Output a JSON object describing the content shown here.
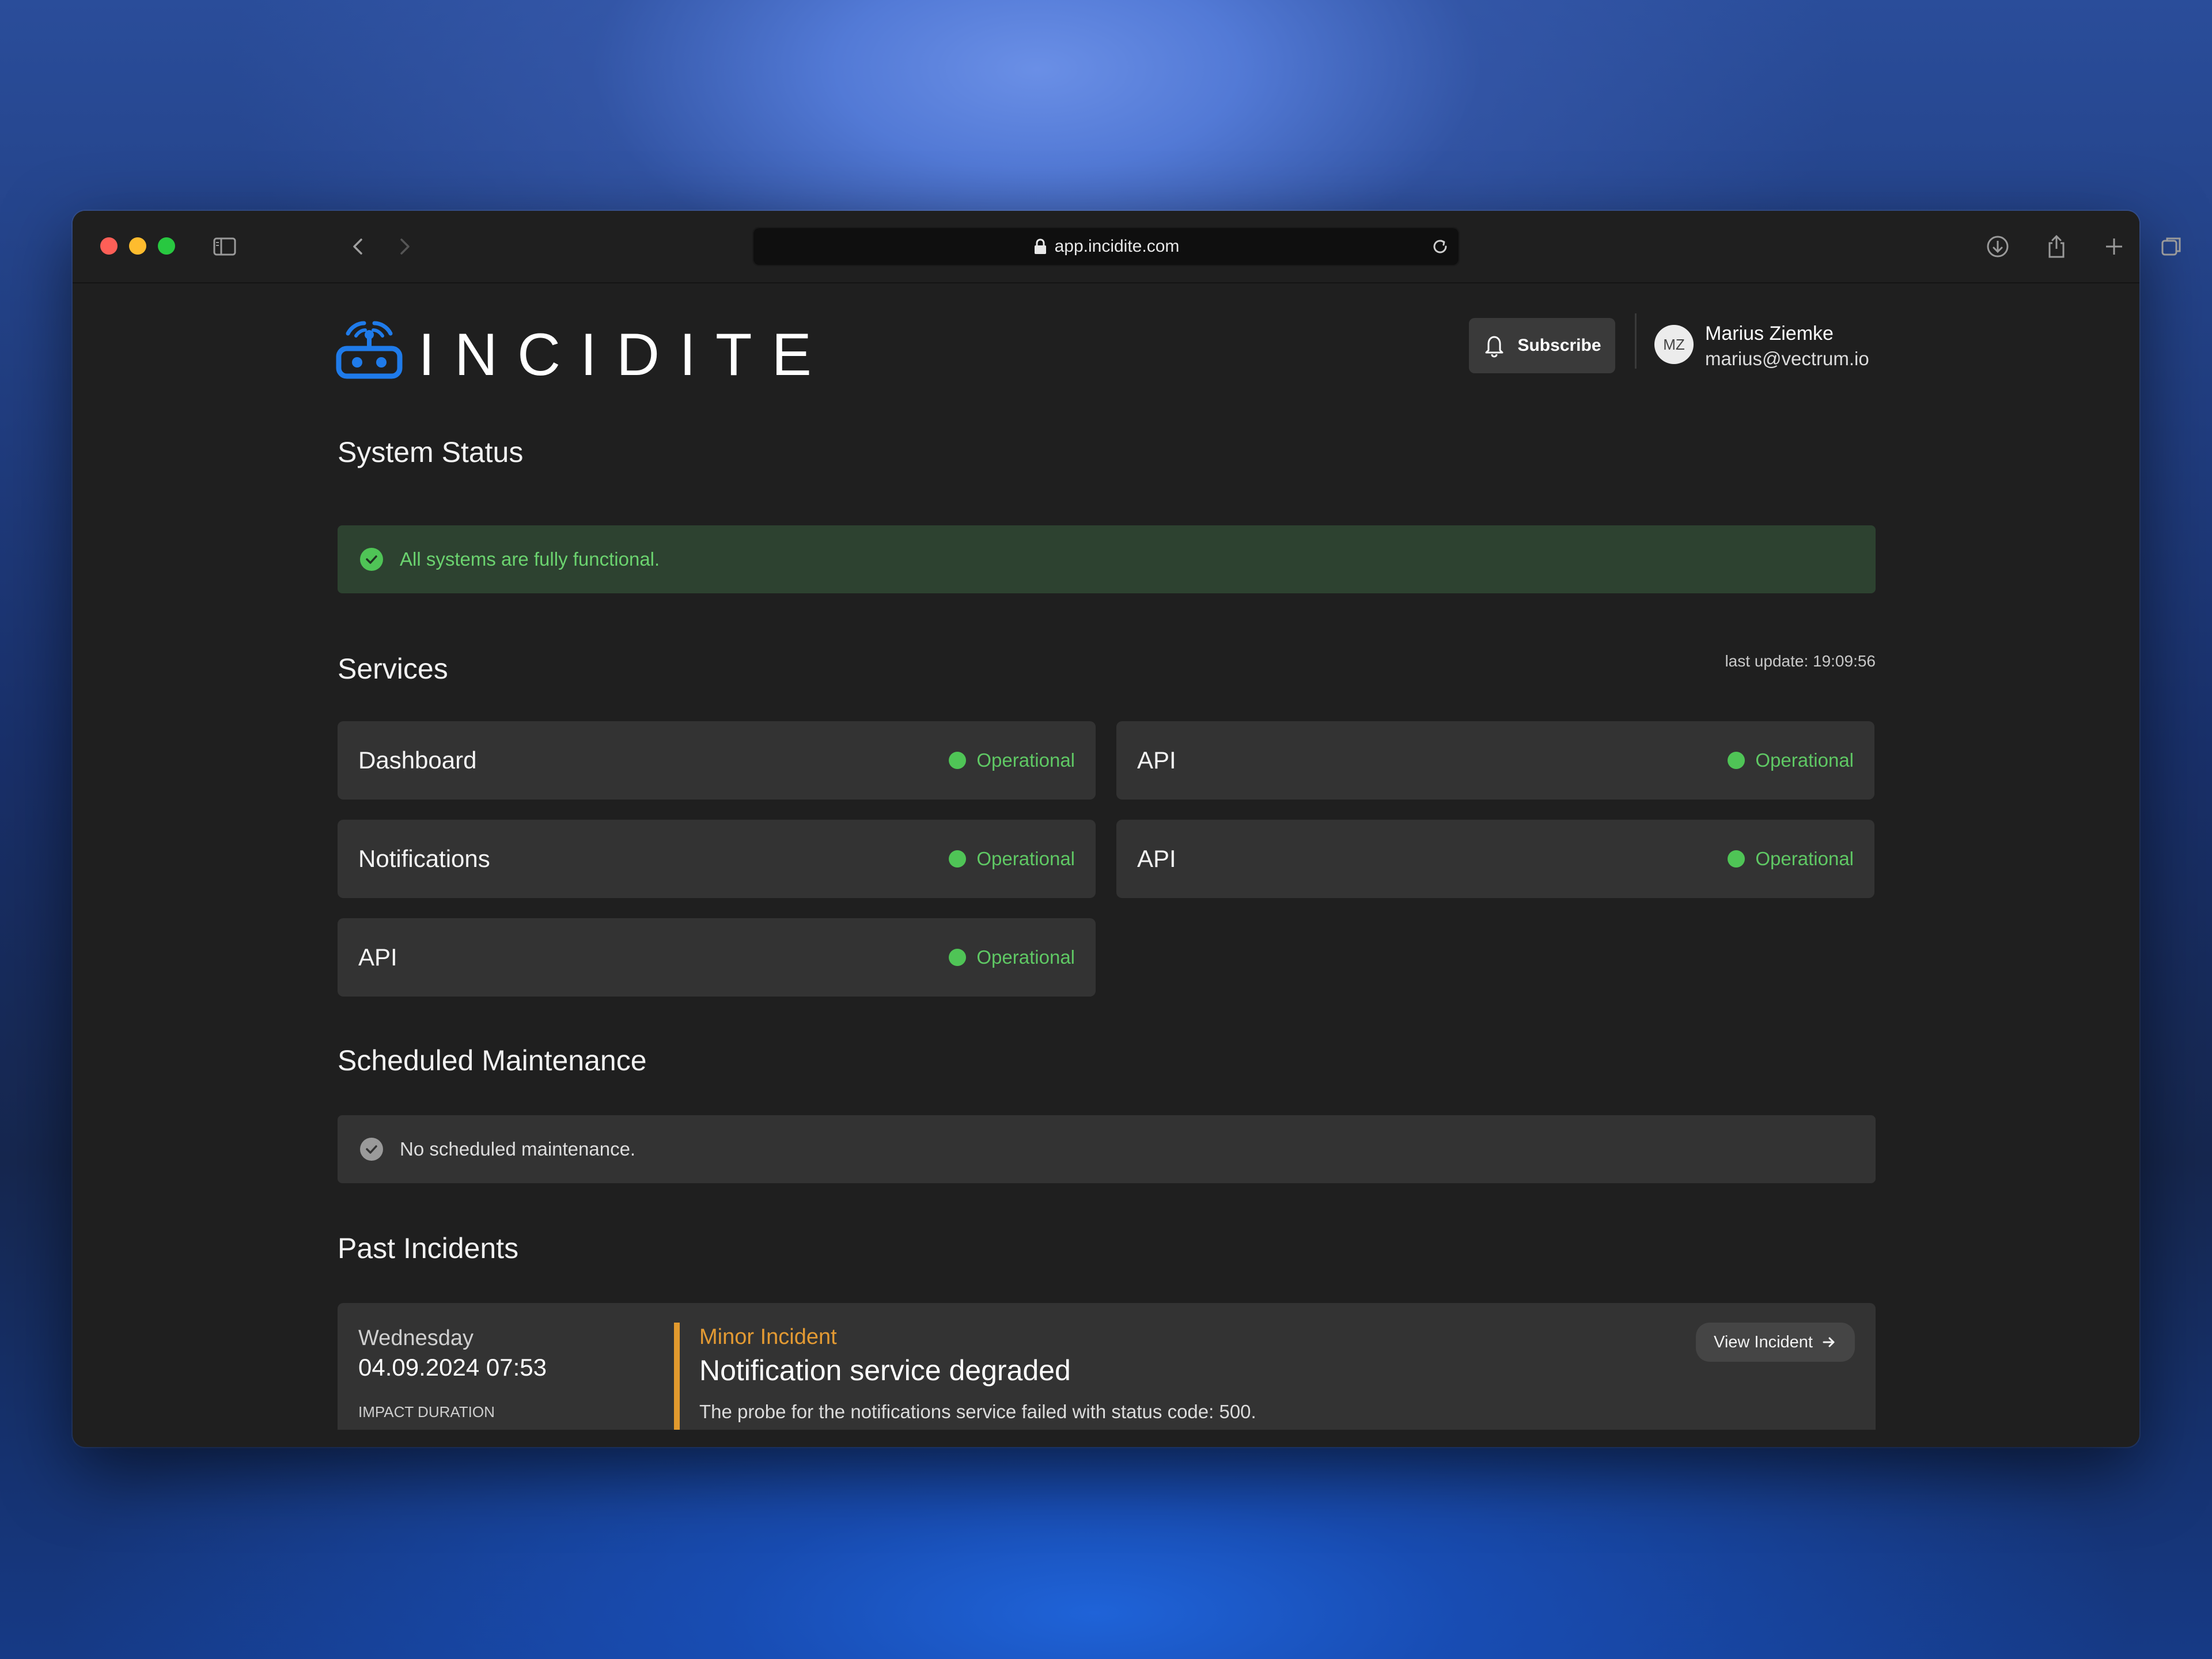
{
  "browser": {
    "url": "app.incidite.com"
  },
  "header": {
    "logo_text": "INCIDITE",
    "subscribe_label": "Subscribe",
    "user": {
      "initials": "MZ",
      "name": "Marius Ziemke",
      "email": "marius@vectrum.io"
    }
  },
  "system_status": {
    "title": "System Status",
    "message": "All systems are fully functional."
  },
  "services": {
    "title": "Services",
    "last_update": "last update: 19:09:56",
    "items": [
      {
        "name": "Dashboard",
        "status": "Operational"
      },
      {
        "name": "API",
        "status": "Operational"
      },
      {
        "name": "Notifications",
        "status": "Operational"
      },
      {
        "name": "API",
        "status": "Operational"
      },
      {
        "name": "API",
        "status": "Operational"
      }
    ]
  },
  "maintenance": {
    "title": "Scheduled Maintenance",
    "message": "No scheduled maintenance."
  },
  "past_incidents": {
    "title": "Past Incidents",
    "items": [
      {
        "day": "Wednesday",
        "datetime": "04.09.2024 07:53",
        "impact_label": "IMPACT DURATION",
        "severity": "Minor Incident",
        "title": "Notification service degraded",
        "description": "The probe for the notifications service failed with status code: 500.",
        "action_label": "View Incident"
      }
    ]
  },
  "colors": {
    "operational": "#4fc456",
    "minor_incident": "#e29a2e",
    "banner_bg": "#2d4230",
    "brand_blue": "#1f7bea"
  }
}
